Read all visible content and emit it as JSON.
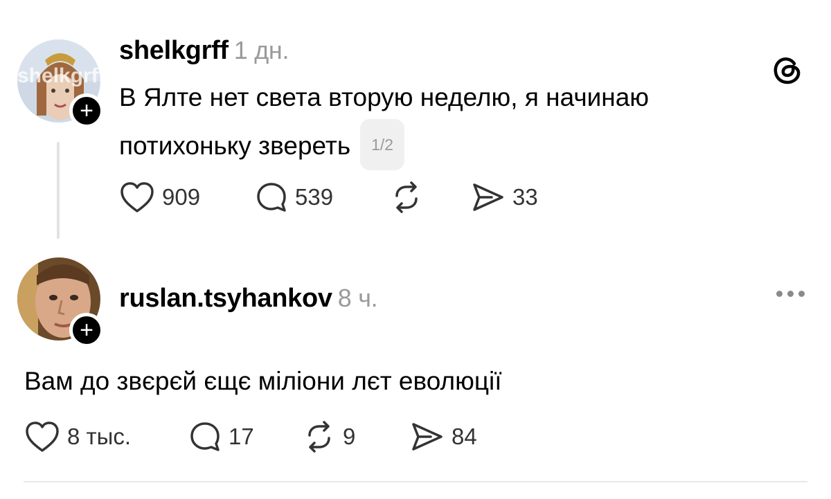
{
  "post1": {
    "username": "shelkgrff",
    "time": "1 дн.",
    "text_line1": "В Ялте нет света вторую неделю, я начинаю",
    "text_line2": "потихоньку звереть",
    "page_indicator": "1/2",
    "likes": "909",
    "comments": "539",
    "shares": "33",
    "avatar_text": "shelkgrff"
  },
  "post2": {
    "username": "ruslan.tsyhankov",
    "time": "8 ч.",
    "text": "Вам до звєрєй єщє міліони лєт еволюції",
    "likes": "8 тыс.",
    "comments": "17",
    "reposts": "9",
    "shares": "84"
  },
  "icons": {
    "like": "heart-icon",
    "comment": "speech-bubble-icon",
    "repost": "repost-icon",
    "share": "send-icon",
    "brand": "threads-logo-icon",
    "more": "more-dots-icon",
    "follow": "plus-icon"
  },
  "colors": {
    "text": "#000000",
    "muted": "#9a9a9a",
    "icon": "#333333",
    "divider": "#e8e8e8"
  }
}
